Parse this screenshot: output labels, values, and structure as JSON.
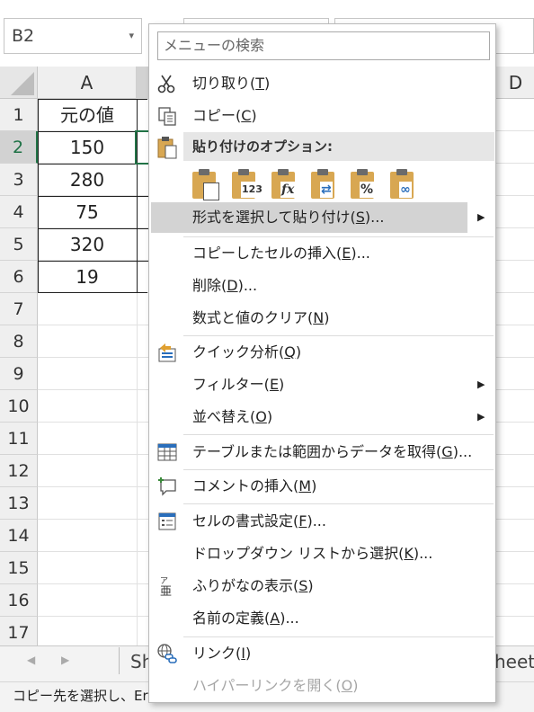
{
  "name_box": {
    "value": "B2"
  },
  "columns": {
    "a": "A",
    "d": "D"
  },
  "rows": [
    "1",
    "2",
    "3",
    "4",
    "5",
    "6",
    "7",
    "8",
    "9",
    "10",
    "11",
    "12",
    "13",
    "14",
    "15",
    "16",
    "17"
  ],
  "cells": [
    "元の値",
    "150",
    "280",
    "75",
    "320",
    "19"
  ],
  "sheet_tabs": {
    "left_fragment": "Sh",
    "right_fragment": "heet"
  },
  "status_bar": {
    "text": "コピー先を選択し、Er"
  },
  "context_menu": {
    "search_placeholder": "メニューの検索",
    "items": [
      {
        "text": "切り取り(",
        "key": "T",
        "tail": ")",
        "icon": "scissors-icon"
      },
      {
        "text": "コピー(",
        "key": "C",
        "tail": ")",
        "icon": "copy-icon"
      },
      {
        "text": "貼り付けのオプション:",
        "key": "",
        "tail": "",
        "icon": "paste-icon"
      },
      {
        "text": "形式を選択して貼り付け(",
        "key": "S",
        "tail": ")...",
        "icon": ""
      },
      {
        "text": "コピーしたセルの挿入(",
        "key": "E",
        "tail": ")...",
        "icon": ""
      },
      {
        "text": "削除(",
        "key": "D",
        "tail": ")...",
        "icon": ""
      },
      {
        "text": "数式と値のクリア(",
        "key": "N",
        "tail": ")",
        "icon": ""
      },
      {
        "text": "クイック分析(",
        "key": "Q",
        "tail": ")",
        "icon": "quick-analysis-icon"
      },
      {
        "text": "フィルター(",
        "key": "E",
        "tail": ")",
        "icon": ""
      },
      {
        "text": "並べ替え(",
        "key": "O",
        "tail": ")",
        "icon": ""
      },
      {
        "text": "テーブルまたは範囲からデータを取得(",
        "key": "G",
        "tail": ")...",
        "icon": "table-icon"
      },
      {
        "text": "コメントの挿入(",
        "key": "M",
        "tail": ")",
        "icon": "comment-icon"
      },
      {
        "text": "セルの書式設定(",
        "key": "F",
        "tail": ")...",
        "icon": "format-cells-icon"
      },
      {
        "text": "ドロップダウン リストから選択(",
        "key": "K",
        "tail": ")...",
        "icon": ""
      },
      {
        "text": "ふりがなの表示(",
        "key": "S",
        "tail": ")",
        "icon": "furigana-icon"
      },
      {
        "text": "名前の定義(",
        "key": "A",
        "tail": ")...",
        "icon": ""
      },
      {
        "text": "リンク(",
        "key": "I",
        "tail": ")",
        "icon": "link-icon"
      },
      {
        "text": "ハイパーリンクを開く(",
        "key": "O",
        "tail": ")",
        "icon": ""
      }
    ],
    "paste_options": [
      "paste-icon",
      "paste-values-icon",
      "paste-formulas-icon",
      "paste-transpose-icon",
      "paste-formatting-icon",
      "paste-link-icon"
    ],
    "paste_glyphs": [
      "",
      "123",
      "fx",
      "⇄",
      "%",
      "∞"
    ]
  },
  "colors": {
    "accent": "#217346",
    "menu_hover": "#d3d3d3",
    "disabled_text": "#a6a6a6"
  }
}
